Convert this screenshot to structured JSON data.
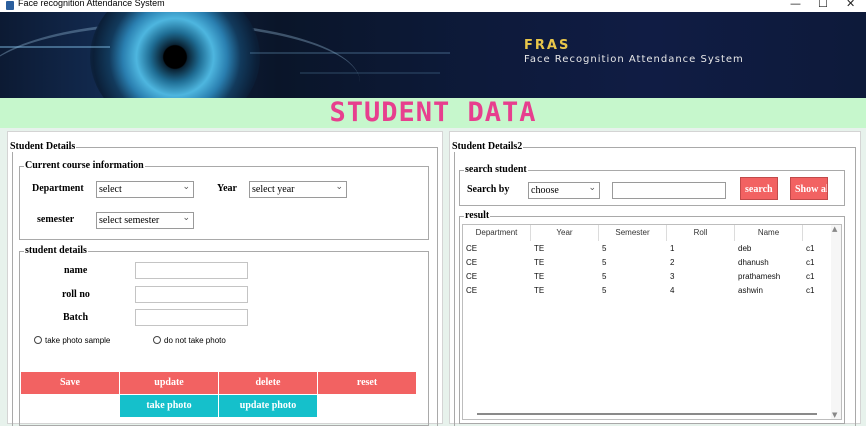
{
  "window": {
    "title": "Face recognition Attendance System",
    "controls": [
      "—",
      "☐",
      "✕"
    ]
  },
  "banner": {
    "acronym": "FRAS",
    "subtitle": "Face Recognition Attendance System"
  },
  "heading": "STUDENT DATA",
  "left_panel": {
    "legend": "Student Details",
    "course": {
      "legend": "Current course information",
      "department_label": "Department",
      "department_value": "select",
      "year_label": "Year",
      "year_value": "select year",
      "semester_label": "semester",
      "semester_value": "select semester"
    },
    "student": {
      "legend": "student details",
      "name_label": "name",
      "roll_label": "roll no",
      "batch_label": "Batch",
      "radio_take": "take photo sample",
      "radio_skip": "do not take photo"
    },
    "buttons": {
      "save": "Save",
      "update": "update",
      "delete": "delete",
      "reset": "reset",
      "take_photo": "take photo",
      "update_photo": "update photo"
    }
  },
  "right_panel": {
    "legend": "Student Details2",
    "search": {
      "legend": "search student",
      "label": "Search by",
      "combo_value": "choose",
      "search_button": "search",
      "show_all_button": "Show al"
    },
    "result": {
      "legend": "result",
      "columns": [
        "Department",
        "Year",
        "Semester",
        "Roll",
        "Name"
      ],
      "rows": [
        {
          "dept": "CE",
          "year": "TE",
          "sem": "5",
          "roll": "1",
          "name": "deb",
          "extra": "c1"
        },
        {
          "dept": "CE",
          "year": "TE",
          "sem": "5",
          "roll": "2",
          "name": "dhanush",
          "extra": "c1"
        },
        {
          "dept": "CE",
          "year": "TE",
          "sem": "5",
          "roll": "3",
          "name": "prathamesh",
          "extra": "c1"
        },
        {
          "dept": "CE",
          "year": "TE",
          "sem": "5",
          "roll": "4",
          "name": "ashwin",
          "extra": "c1"
        }
      ]
    }
  },
  "colors": {
    "heading_bg": "#c6f7cc",
    "heading_text": "#e73f8e",
    "button_red": "#f26262",
    "button_teal": "#15c0cb",
    "fras_gold": "#e8c64a"
  }
}
